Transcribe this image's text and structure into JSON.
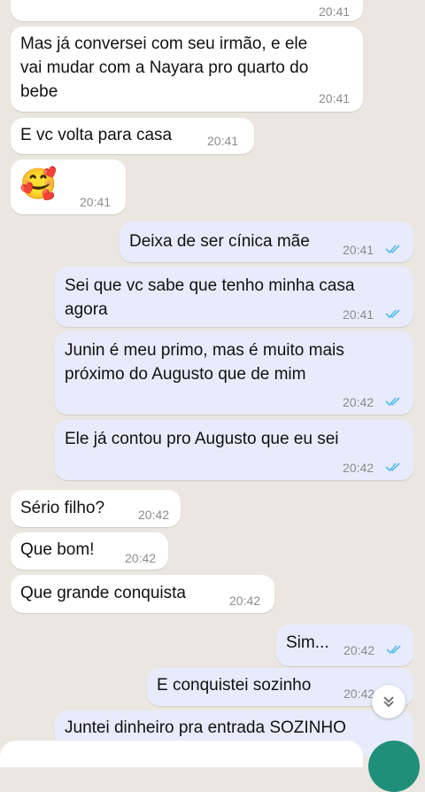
{
  "messages": [
    {
      "text": "",
      "time": "20:41",
      "dir": "in"
    },
    {
      "text": "Mas já conversei com seu irmão, e ele\nvai mudar com a Nayara pro quarto do\nbebe",
      "time": "20:41",
      "dir": "in"
    },
    {
      "text": "E vc volta para casa",
      "time": "20:41",
      "dir": "in"
    },
    {
      "text": "",
      "emoji": "🥰",
      "time": "20:41",
      "dir": "in"
    },
    {
      "text": "Deixa de ser cínica mãe",
      "time": "20:41",
      "dir": "out"
    },
    {
      "text": "Sei que vc sabe que tenho minha casa\nagora",
      "time": "20:41",
      "dir": "out"
    },
    {
      "text": "Junin é meu primo, mas é muito mais\npróximo do Augusto que de mim",
      "time": "20:42",
      "dir": "out"
    },
    {
      "text": "Ele já contou pro Augusto que eu sei",
      "time": "20:42",
      "dir": "out"
    },
    {
      "text": "Sério filho?",
      "time": "20:42",
      "dir": "in"
    },
    {
      "text": "Que bom!",
      "time": "20:42",
      "dir": "in"
    },
    {
      "text": "Que grande conquista",
      "time": "20:42",
      "dir": "in"
    },
    {
      "text": "Sim...",
      "time": "20:42",
      "dir": "out"
    },
    {
      "text": "E conquistei sozinho",
      "time": "20:42",
      "dir": "out"
    },
    {
      "text": "Juntei dinheiro pra entrada SOZINHO",
      "time": "",
      "dir": "out"
    }
  ],
  "icons": {
    "read_ticks": "double-check-icon",
    "scroll_down": "chevron-double-down-icon"
  },
  "colors": {
    "incoming_bubble": "#ffffff",
    "outgoing_bubble": "#e8ebfb",
    "read_tick": "#53bdeb",
    "send_button": "#1f8f7a"
  }
}
